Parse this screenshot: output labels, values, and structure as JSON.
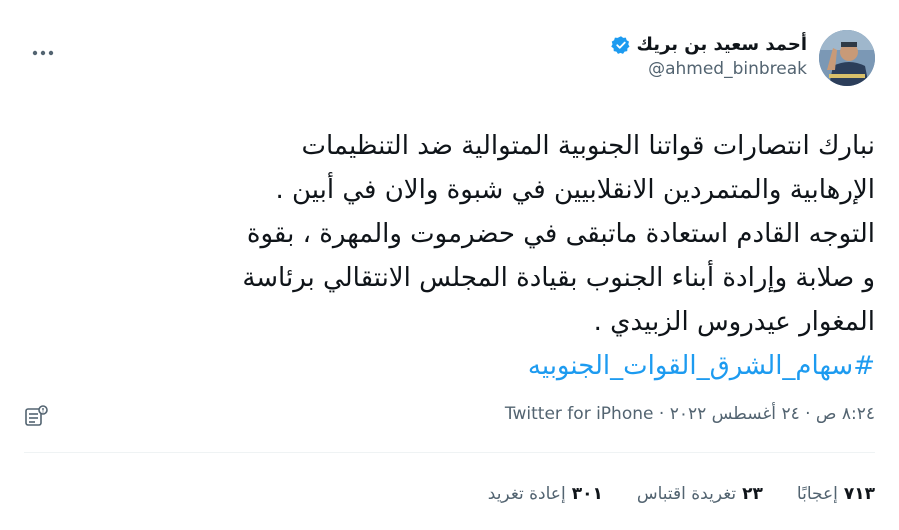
{
  "author": {
    "display_name": "أحمد سعيد بن بريك",
    "handle": "@ahmed_binbreak",
    "verified": true,
    "verified_color": "#1d9bf0"
  },
  "more_icon": "more-dots-icon",
  "tweet": {
    "lines": [
      "نبارك انتصارات قواتنا الجنوبية المتوالية ضد التنظيمات",
      "الإرهابية والمتمردين الانقلابيين في شبوة والان في أبين .",
      "التوجه القادم استعادة ماتبقى في حضرموت والمهرة ، بقوة",
      "و صلابة وإرادة أبناء الجنوب بقيادة المجلس الانتقالي برئاسة",
      "المغوار عيدروس الزبيدي ."
    ],
    "hashtag": "#سهام_الشرق_القوات_الجنوبيه",
    "hashtag_color": "#1d9bf0"
  },
  "meta": {
    "text": "٨:٢٤ ص · ٢٤ أغسطس ٢٠٢٢ · Twitter for iPhone",
    "notes_icon": "document-notes-icon"
  },
  "stats": {
    "retweets": {
      "count": "٣٠١",
      "label": "إعادة تغريد"
    },
    "quotes": {
      "count": "٢٣",
      "label": "تغريدة اقتباس"
    },
    "likes": {
      "count": "٧١٣",
      "label": "إعجابًا"
    }
  }
}
